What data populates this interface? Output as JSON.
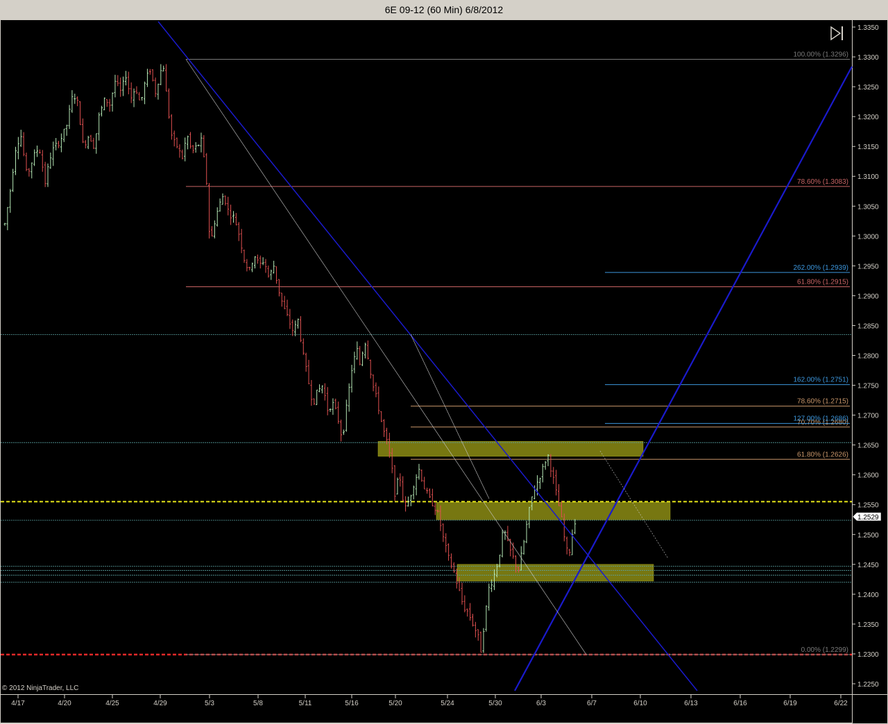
{
  "window": {
    "title": "6E 09-12 (60 Min)  6/8/2012"
  },
  "copyright": "© 2012 NinjaTrader, LLC",
  "colors": {
    "background": "#000000",
    "axis": "#d4d0c8",
    "trendline": "#1a1acc",
    "fib_retracement": "#c86464",
    "fib_retracement_small": "#c8966a",
    "fib_extension": "#3c96dc",
    "zone_fill": "#8c8c14",
    "current_price_line": "#e6e619",
    "support_dashed": "#e62828",
    "horizontal_cyan": "#5aa0a0",
    "bar_up": "#b4e6b4",
    "bar_down": "#e05050"
  },
  "chart_data": {
    "type": "candlestick",
    "instrument": "6E 09-12",
    "interval": "60 Min",
    "date": "6/8/2012",
    "y_axis": {
      "range": [
        1.2225,
        1.3355
      ],
      "ticks": [
        "1.3350",
        "1.3300",
        "1.3250",
        "1.3200",
        "1.3150",
        "1.3100",
        "1.3050",
        "1.3000",
        "1.2950",
        "1.2900",
        "1.2850",
        "1.2800",
        "1.2750",
        "1.2700",
        "1.2650",
        "1.2600",
        "1.2550",
        "1.2500",
        "1.2450",
        "1.2400",
        "1.2350",
        "1.2300",
        "1.2250"
      ],
      "current_price_label": "1.2529"
    },
    "x_axis": {
      "ticks": [
        "4/17",
        "4/20",
        "4/25",
        "4/29",
        "5/3",
        "5/8",
        "5/11",
        "5/16",
        "5/20",
        "5/24",
        "5/30",
        "6/3",
        "6/7",
        "6/10",
        "6/13",
        "6/16",
        "6/19",
        "6/22"
      ]
    },
    "price_path": [
      [
        0.0,
        1.302
      ],
      [
        0.4,
        1.307
      ],
      [
        0.9,
        1.315
      ],
      [
        1.3,
        1.317
      ],
      [
        1.8,
        1.31
      ],
      [
        2.3,
        1.313
      ],
      [
        2.8,
        1.315
      ],
      [
        3.3,
        1.309
      ],
      [
        3.8,
        1.314
      ],
      [
        4.5,
        1.316
      ],
      [
        5.0,
        1.318
      ],
      [
        5.6,
        1.324
      ],
      [
        6.0,
        1.322
      ],
      [
        6.4,
        1.315
      ],
      [
        6.9,
        1.317
      ],
      [
        7.3,
        1.315
      ],
      [
        7.7,
        1.32
      ],
      [
        8.2,
        1.323
      ],
      [
        8.6,
        1.322
      ],
      [
        9.0,
        1.326
      ],
      [
        9.5,
        1.324
      ],
      [
        9.9,
        1.327
      ],
      [
        10.3,
        1.323
      ],
      [
        10.7,
        1.325
      ],
      [
        11.1,
        1.322
      ],
      [
        11.5,
        1.326
      ],
      [
        11.9,
        1.328
      ],
      [
        12.3,
        1.324
      ],
      [
        12.6,
        1.3265
      ],
      [
        12.95,
        1.329
      ],
      [
        13.3,
        1.322
      ],
      [
        13.7,
        1.316
      ],
      [
        14.1,
        1.315
      ],
      [
        14.5,
        1.313
      ],
      [
        14.9,
        1.317
      ],
      [
        15.3,
        1.314
      ],
      [
        15.7,
        1.315
      ],
      [
        16.1,
        1.316
      ],
      [
        16.5,
        1.309
      ],
      [
        16.8,
        1.298
      ],
      [
        17.1,
        1.302
      ],
      [
        17.5,
        1.305
      ],
      [
        17.9,
        1.307
      ],
      [
        18.3,
        1.304
      ],
      [
        18.8,
        1.303
      ],
      [
        19.2,
        1.3
      ],
      [
        19.6,
        1.296
      ],
      [
        20.0,
        1.294
      ],
      [
        20.4,
        1.297
      ],
      [
        20.8,
        1.295
      ],
      [
        21.2,
        1.296
      ],
      [
        21.6,
        1.293
      ],
      [
        22.0,
        1.295
      ],
      [
        22.4,
        1.291
      ],
      [
        22.8,
        1.288
      ],
      [
        23.2,
        1.286
      ],
      [
        23.6,
        1.284
      ],
      [
        24.0,
        1.286
      ],
      [
        24.4,
        1.28
      ],
      [
        24.8,
        1.276
      ],
      [
        25.2,
        1.272
      ],
      [
        25.6,
        1.274
      ],
      [
        26.0,
        1.275
      ],
      [
        26.4,
        1.271
      ],
      [
        26.8,
        1.272
      ],
      [
        27.2,
        1.27
      ],
      [
        27.6,
        1.266
      ],
      [
        28.0,
        1.272
      ],
      [
        28.4,
        1.278
      ],
      [
        28.8,
        1.281
      ],
      [
        29.1,
        1.278
      ],
      [
        29.4,
        1.283
      ],
      [
        29.7,
        1.28
      ],
      [
        30.1,
        1.275
      ],
      [
        30.5,
        1.272
      ],
      [
        30.9,
        1.268
      ],
      [
        31.3,
        1.265
      ],
      [
        31.6,
        1.262
      ],
      [
        31.9,
        1.257
      ],
      [
        32.3,
        1.26
      ],
      [
        32.7,
        1.254
      ],
      [
        33.1,
        1.256
      ],
      [
        33.5,
        1.259
      ],
      [
        33.9,
        1.261
      ],
      [
        34.3,
        1.258
      ],
      [
        34.7,
        1.256
      ],
      [
        35.1,
        1.255
      ],
      [
        35.5,
        1.253
      ],
      [
        35.9,
        1.249
      ],
      [
        36.3,
        1.246
      ],
      [
        36.7,
        1.244
      ],
      [
        37.1,
        1.241
      ],
      [
        37.5,
        1.238
      ],
      [
        37.9,
        1.237
      ],
      [
        38.3,
        1.235
      ],
      [
        38.7,
        1.233
      ],
      [
        38.9,
        1.23
      ],
      [
        39.2,
        1.235
      ],
      [
        39.6,
        1.241
      ],
      [
        40.0,
        1.243
      ],
      [
        40.4,
        1.246
      ],
      [
        40.8,
        1.251
      ],
      [
        41.2,
        1.248
      ],
      [
        41.6,
        1.246
      ],
      [
        42.0,
        1.244
      ],
      [
        42.4,
        1.248
      ],
      [
        42.8,
        1.253
      ],
      [
        43.2,
        1.257
      ],
      [
        43.6,
        1.259
      ],
      [
        44.0,
        1.261
      ],
      [
        44.4,
        1.2635
      ],
      [
        44.8,
        1.26
      ],
      [
        45.2,
        1.256
      ],
      [
        45.5,
        1.253
      ],
      [
        45.8,
        1.249
      ],
      [
        46.1,
        1.246
      ],
      [
        46.4,
        1.25
      ],
      [
        46.7,
        1.2529
      ]
    ],
    "fib_retracement_major": {
      "high": 1.3296,
      "low": 1.2299,
      "levels": [
        {
          "label": "100.00% (1.3296)",
          "price": 1.3296
        },
        {
          "label": "78.60% (1.3083)",
          "price": 1.3083
        },
        {
          "label": "61.80% (1.2915)",
          "price": 1.2915
        },
        {
          "label": "0.00% (1.2299)",
          "price": 1.2299
        }
      ]
    },
    "fib_retracement_minor": [
      {
        "label": "78.60% (1.2715)",
        "price": 1.2715
      },
      {
        "label": "70.70% (1.2680)",
        "price": 1.268
      },
      {
        "label": "61.80% (1.2626)",
        "price": 1.2626
      }
    ],
    "fib_extension": [
      {
        "label": "262.00% (1.2939)",
        "price": 1.2939
      },
      {
        "label": "162.00% (1.2751)",
        "price": 1.2751
      },
      {
        "label": "127.00% (1.2686)",
        "price": 1.2686
      }
    ],
    "horizontal_lines": [
      1.2835,
      1.2654,
      1.2524,
      1.2447,
      1.244,
      1.2432,
      1.242
    ],
    "current_price_line": 1.2555,
    "support_line": 1.2299,
    "zones": [
      {
        "from": 1.2631,
        "to": 1.2656
      },
      {
        "from": 1.2525,
        "to": 1.2554
      },
      {
        "from": 1.2422,
        "to": 1.245
      }
    ]
  }
}
